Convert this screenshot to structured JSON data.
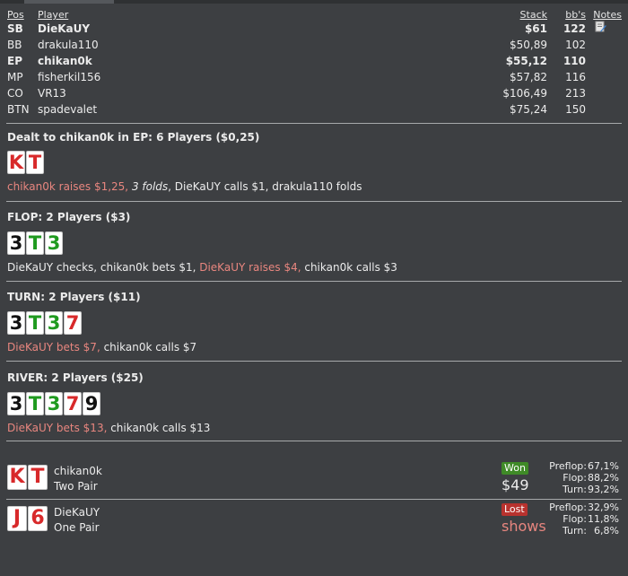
{
  "headers": {
    "pos": "Pos",
    "player": "Player",
    "stack": "Stack",
    "bbs": "bb's",
    "notes": "Notes"
  },
  "players": [
    {
      "pos": "SB",
      "name": "DieKaUY",
      "stack": "$61",
      "bbs": "122",
      "bold": true,
      "note": true
    },
    {
      "pos": "BB",
      "name": "drakula110",
      "stack": "$50,89",
      "bbs": "102"
    },
    {
      "pos": "EP",
      "name": "chikan0k",
      "stack": "$55,12",
      "bbs": "110",
      "bold": true
    },
    {
      "pos": "MP",
      "name": "fisherkil156",
      "stack": "$57,82",
      "bbs": "116"
    },
    {
      "pos": "CO",
      "name": "VR13",
      "stack": "$106,49",
      "bbs": "213"
    },
    {
      "pos": "BTN",
      "name": "spadevalet",
      "stack": "$75,24",
      "bbs": "150"
    }
  ],
  "colors": {
    "red": "#d8292a",
    "green": "#1f9a1f",
    "black": "#111111",
    "highlight": "#e8867f"
  },
  "sections": [
    {
      "title": "Dealt to chikan0k in EP: 6 Players ($0,25)",
      "cards": [
        {
          "r": "K",
          "c": "red"
        },
        {
          "r": "T",
          "c": "red"
        }
      ],
      "actions": [
        {
          "t": "chikan0k raises $1,25,",
          "s": "hl"
        },
        {
          "t": " ",
          "s": ""
        },
        {
          "t": "3 folds",
          "s": "it"
        },
        {
          "t": ", DieKaUY calls $1, drakula110 folds",
          "s": ""
        }
      ]
    },
    {
      "title": "FLOP: 2 Players ($3)",
      "cards": [
        {
          "r": "3",
          "c": "black"
        },
        {
          "r": "T",
          "c": "green"
        },
        {
          "r": "3",
          "c": "green"
        }
      ],
      "actions": [
        {
          "t": "DieKaUY checks, chikan0k bets $1, ",
          "s": ""
        },
        {
          "t": "DieKaUY raises $4,",
          "s": "hl"
        },
        {
          "t": " chikan0k calls $3",
          "s": ""
        }
      ]
    },
    {
      "title": "TURN: 2 Players ($11)",
      "cards": [
        {
          "r": "3",
          "c": "black"
        },
        {
          "r": "T",
          "c": "green"
        },
        {
          "r": "3",
          "c": "green"
        },
        {
          "r": "7",
          "c": "red"
        }
      ],
      "actions": [
        {
          "t": "DieKaUY bets $7,",
          "s": "hl"
        },
        {
          "t": " chikan0k calls $7",
          "s": ""
        }
      ]
    },
    {
      "title": "RIVER: 2 Players ($25)",
      "cards": [
        {
          "r": "3",
          "c": "black"
        },
        {
          "r": "T",
          "c": "green"
        },
        {
          "r": "3",
          "c": "green"
        },
        {
          "r": "7",
          "c": "red"
        },
        {
          "r": "9",
          "c": "black"
        }
      ],
      "actions": [
        {
          "t": "DieKaUY bets $13,",
          "s": "hl"
        },
        {
          "t": " chikan0k calls $13",
          "s": ""
        }
      ]
    }
  ],
  "results": [
    {
      "cards": [
        {
          "r": "K",
          "c": "red"
        },
        {
          "r": "T",
          "c": "red"
        }
      ],
      "name": "chikan0k",
      "hand": "Two Pair",
      "badge": "Won",
      "badge_type": "won",
      "amount": "$49",
      "equity": [
        {
          "label": "Preflop:",
          "value": "67,1%"
        },
        {
          "label": "Flop:",
          "value": "88,2%"
        },
        {
          "label": "Turn:",
          "value": "93,2%"
        }
      ]
    },
    {
      "cards": [
        {
          "r": "J",
          "c": "red"
        },
        {
          "r": "6",
          "c": "red"
        }
      ],
      "name": "DieKaUY",
      "hand": "One Pair",
      "badge": "Lost",
      "badge_type": "lost",
      "amount": "shows",
      "equity": [
        {
          "label": "Preflop:",
          "value": "32,9%"
        },
        {
          "label": "Flop:",
          "value": "11,8%"
        },
        {
          "label": "Turn:",
          "value": "6,8%"
        }
      ]
    }
  ]
}
